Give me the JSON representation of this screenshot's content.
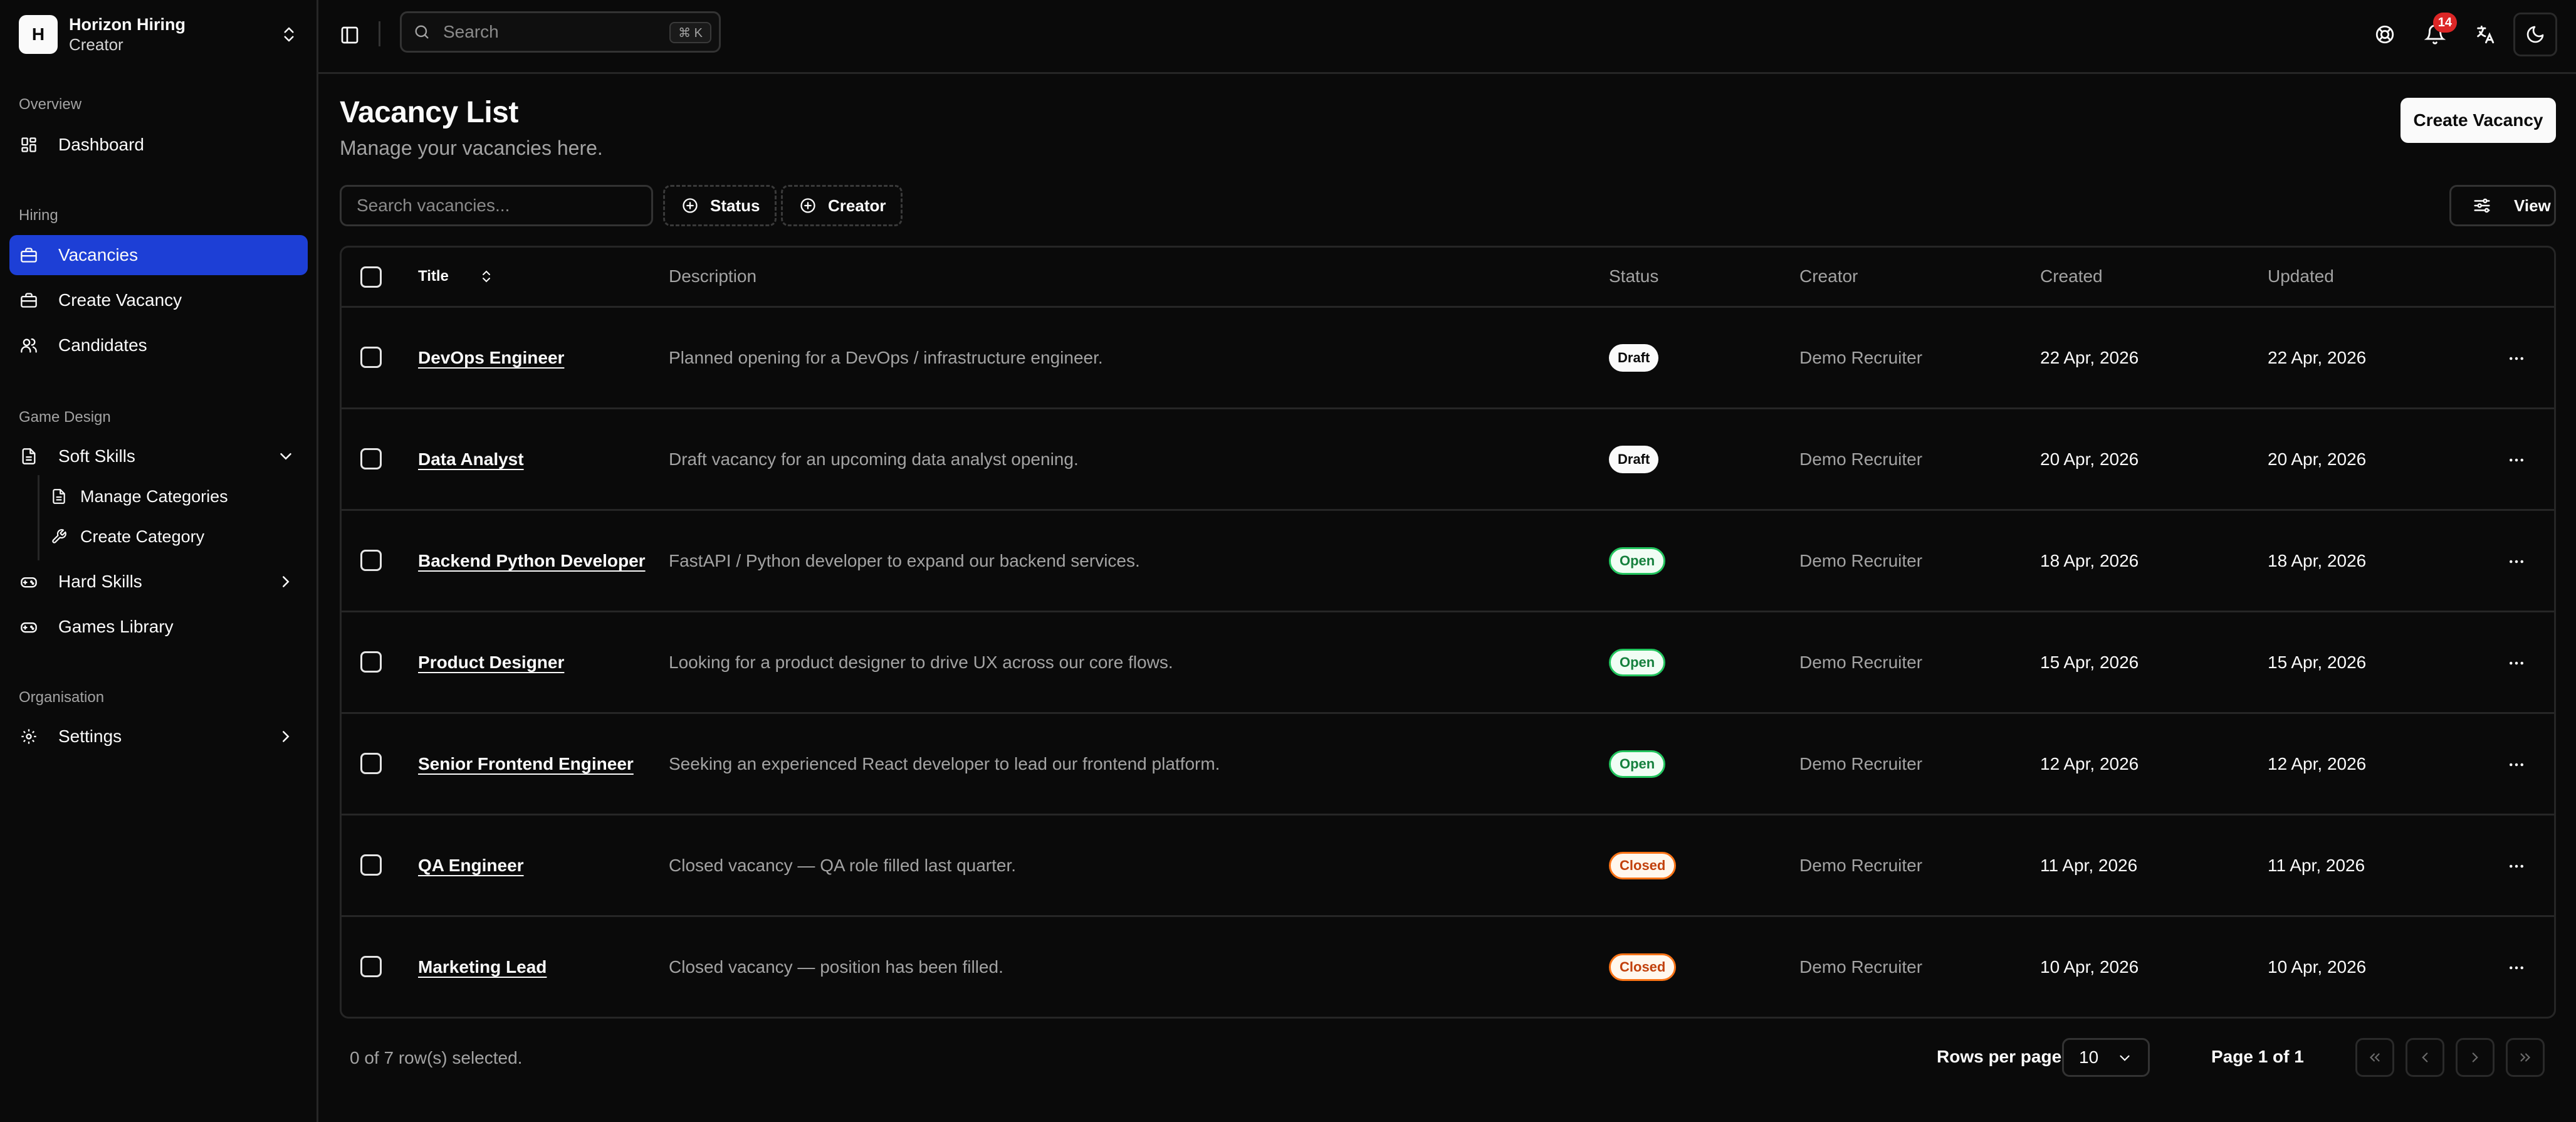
{
  "org": {
    "initial": "H",
    "name": "Horizon Hiring",
    "role": "Creator"
  },
  "sidebar": {
    "groups": [
      {
        "label": "Overview"
      },
      {
        "label": "Hiring"
      },
      {
        "label": "Game Design"
      },
      {
        "label": "Organisation"
      }
    ],
    "items": {
      "dashboard": "Dashboard",
      "vacancies": "Vacancies",
      "create_vacancy": "Create Vacancy",
      "candidates": "Candidates",
      "soft_skills": "Soft Skills",
      "manage_categories": "Manage Categories",
      "create_category": "Create Category",
      "hard_skills": "Hard Skills",
      "games_library": "Games Library",
      "settings": "Settings"
    },
    "active": "vacancies"
  },
  "topbar": {
    "search_placeholder": "Search",
    "search_shortcut": "⌘ K",
    "notification_count": "14"
  },
  "page": {
    "title": "Vacancy List",
    "subtitle": "Manage your vacancies here.",
    "create_button": "Create Vacancy"
  },
  "filters": {
    "search_placeholder": "Search vacancies...",
    "status_label": "Status",
    "creator_label": "Creator",
    "view_label": "View"
  },
  "table": {
    "columns": [
      "Title",
      "Description",
      "Status",
      "Creator",
      "Created",
      "Updated"
    ],
    "rows": [
      {
        "title": "DevOps Engineer",
        "description": "Planned opening for a DevOps / infrastructure engineer.",
        "status": "Draft",
        "creator": "Demo Recruiter",
        "created": "22 Apr, 2026",
        "updated": "22 Apr, 2026"
      },
      {
        "title": "Data Analyst",
        "description": "Draft vacancy for an upcoming data analyst opening.",
        "status": "Draft",
        "creator": "Demo Recruiter",
        "created": "20 Apr, 2026",
        "updated": "20 Apr, 2026"
      },
      {
        "title": "Backend Python Developer",
        "description": "FastAPI / Python developer to expand our backend services.",
        "status": "Open",
        "creator": "Demo Recruiter",
        "created": "18 Apr, 2026",
        "updated": "18 Apr, 2026"
      },
      {
        "title": "Product Designer",
        "description": "Looking for a product designer to drive UX across our core flows.",
        "status": "Open",
        "creator": "Demo Recruiter",
        "created": "15 Apr, 2026",
        "updated": "15 Apr, 2026"
      },
      {
        "title": "Senior Frontend Engineer",
        "description": "Seeking an experienced React developer to lead our frontend platform.",
        "status": "Open",
        "creator": "Demo Recruiter",
        "created": "12 Apr, 2026",
        "updated": "12 Apr, 2026"
      },
      {
        "title": "QA Engineer",
        "description": "Closed vacancy — QA role filled last quarter.",
        "status": "Closed",
        "creator": "Demo Recruiter",
        "created": "11 Apr, 2026",
        "updated": "11 Apr, 2026"
      },
      {
        "title": "Marketing Lead",
        "description": "Closed vacancy — position has been filled.",
        "status": "Closed",
        "creator": "Demo Recruiter",
        "created": "10 Apr, 2026",
        "updated": "10 Apr, 2026"
      }
    ]
  },
  "footer": {
    "selection_text": "0 of 7 row(s) selected.",
    "rows_per_page_label": "Rows per page",
    "rows_per_page_value": "10",
    "page_info": "Page 1 of 1"
  },
  "colors": {
    "accent": "#1d3fd6",
    "background": "#0a0a0a",
    "border": "#262626"
  }
}
